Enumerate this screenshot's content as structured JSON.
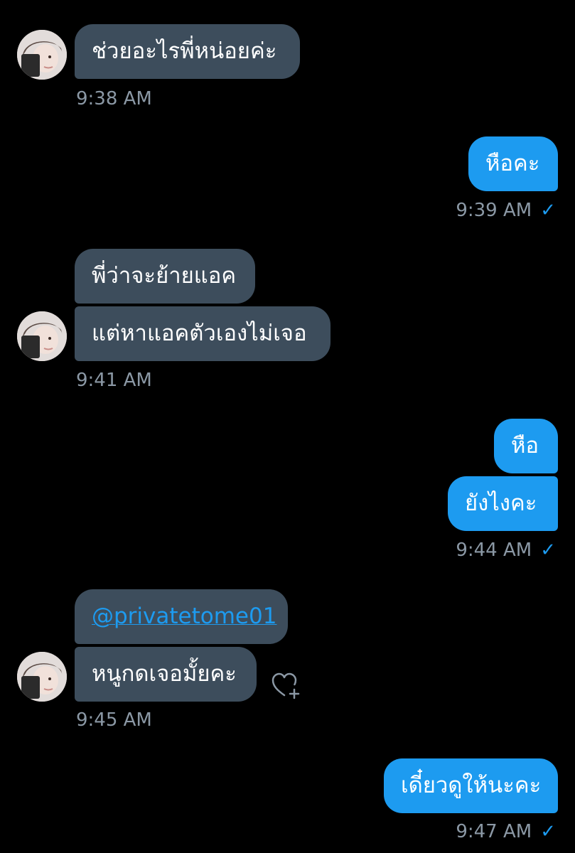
{
  "messages": [
    {
      "text": "ช่วยอะไรพี่หน่อยค่ะ"
    },
    {
      "text": "หือคะ"
    },
    {
      "text": "พี่ว่าจะย้ายแอค"
    },
    {
      "text": "แต่หาแอคตัวเองไม่เจอ"
    },
    {
      "text": "หือ"
    },
    {
      "text": "ยังไงคะ"
    },
    {
      "text": "@privatetome01"
    },
    {
      "text": "หนูกดเจอมั้ยคะ"
    },
    {
      "text": "เดี๋ยวดูให้นะคะ"
    }
  ],
  "timestamps": [
    "9:38 AM",
    "9:39 AM",
    "9:41 AM",
    "9:44 AM",
    "9:45 AM",
    "9:47 AM"
  ],
  "icons": {
    "read_check": "✓",
    "react": "heart-plus-icon",
    "avatar": "user-avatar"
  },
  "colors": {
    "background": "#000000",
    "incoming_bubble": "#3d4d5c",
    "outgoing_bubble": "#1d9bf0",
    "timestamp": "#8b98a5",
    "link": "#1d9bf0"
  }
}
